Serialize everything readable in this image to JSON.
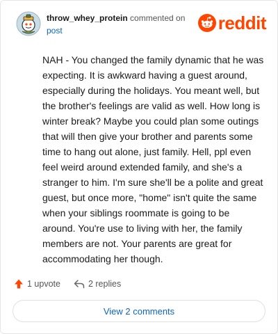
{
  "comment": {
    "username": "throw_whey_protein",
    "action_text": "commented on",
    "post_link": "post",
    "body": "NAH - You changed the family dynamic that he was expecting. It is awkward having a guest around, especially during the holidays. You meant well, but the brother's feelings are valid as well. How long is winter break? Maybe you could plan some outings that will then give your brother and parents some time to hang out alone, just family. Hell, ppl even feel weird around extended family, and she's a stranger to him. I'm sure she'll be a polite and great guest, but once more, \"home\" isn't quite the same when your siblings roommate is going to be around. You're use to living with her, the family members are not. Your parents are great for accommodating her though."
  },
  "brand": {
    "logo_text": "reddit",
    "color": "#ff4500"
  },
  "actions": {
    "upvote_label": "1 upvote",
    "replies_label": "2 replies"
  },
  "footer": {
    "view_comments_label": "View 2 comments"
  },
  "icons": {
    "avatar": "snoo-avatar-icon",
    "upvote": "arrow-up-icon",
    "reply": "reply-arrow-icon"
  }
}
